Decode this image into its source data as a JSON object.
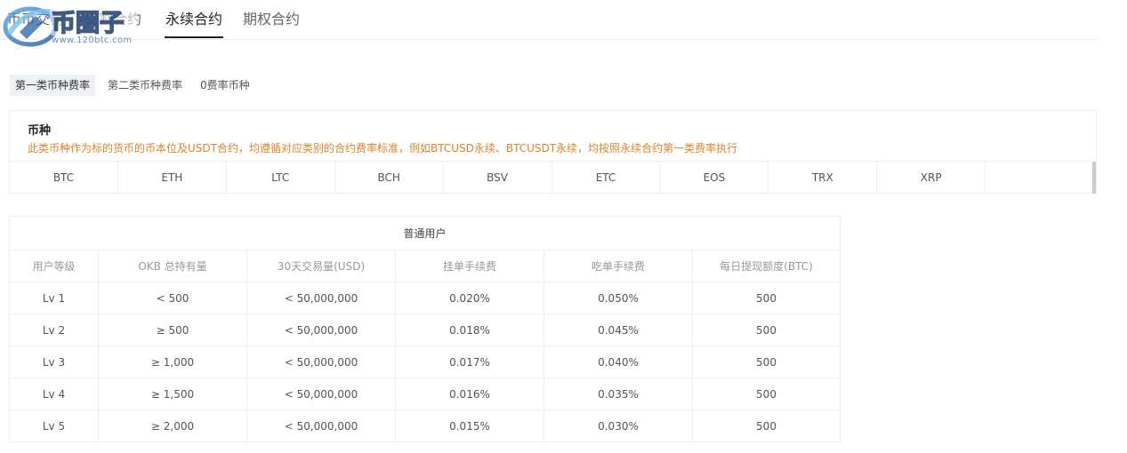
{
  "top_tabs": [
    {
      "label": "币币交易"
    },
    {
      "label": "交割合约"
    },
    {
      "label": "永续合约"
    },
    {
      "label": "期权合约"
    }
  ],
  "watermark": {
    "text": "币圈子",
    "site": "www.120btc.com"
  },
  "fee_tabs": [
    {
      "label": "第一类币种费率"
    },
    {
      "label": "第二类币种费率"
    },
    {
      "label": "0费率币种"
    }
  ],
  "coin_panel": {
    "title": "币种",
    "note": "此类币种作为标的货币的币本位及USDT合约，均遵循对应类别的合约费率标准，例如BTCUSD永续、BTCUSDT永续，均按照永续合约第一类费率执行",
    "coins": [
      "BTC",
      "ETH",
      "LTC",
      "BCH",
      "BSV",
      "ETC",
      "EOS",
      "TRX",
      "XRP"
    ]
  },
  "fee_table": {
    "group_title": "普通用户",
    "columns": [
      "用户等级",
      "OKB 总持有量",
      "30天交易量(USD)",
      "挂单手续费",
      "吃单手续费",
      "每日提现额度(BTC)"
    ],
    "rows": [
      [
        "Lv 1",
        "< 500",
        "< 50,000,000",
        "0.020%",
        "0.050%",
        "500"
      ],
      [
        "Lv 2",
        "≥ 500",
        "< 50,000,000",
        "0.018%",
        "0.045%",
        "500"
      ],
      [
        "Lv 3",
        "≥ 1,000",
        "< 50,000,000",
        "0.017%",
        "0.040%",
        "500"
      ],
      [
        "Lv 4",
        "≥ 1,500",
        "< 50,000,000",
        "0.016%",
        "0.035%",
        "500"
      ],
      [
        "Lv 5",
        "≥ 2,000",
        "< 50,000,000",
        "0.015%",
        "0.030%",
        "500"
      ]
    ]
  }
}
